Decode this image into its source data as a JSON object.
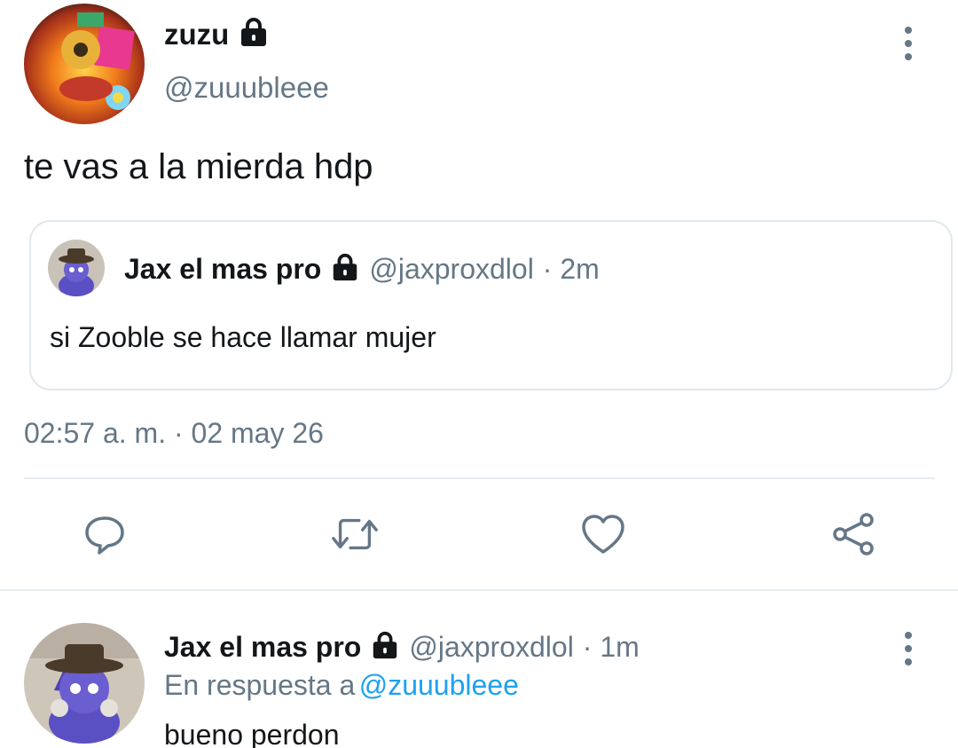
{
  "main_tweet": {
    "display_name": "zuzu",
    "handle": "@zuuubleee",
    "text": "te vas a la mierda hdp",
    "timestamp": "02:57 a. m. · 02 may 26",
    "icons": {
      "avatar": "avatar",
      "lock": "lock-icon",
      "more": "more-options-icon"
    }
  },
  "quoted_tweet": {
    "display_name": "Jax el mas pro",
    "handle": "@jaxproxdlol",
    "time": "· 2m",
    "text": "si Zooble se hace llamar mujer"
  },
  "actions": [
    {
      "name": "reply",
      "icon": "reply-icon"
    },
    {
      "name": "retweet",
      "icon": "retweet-icon"
    },
    {
      "name": "like",
      "icon": "heart-icon"
    },
    {
      "name": "share",
      "icon": "share-icon"
    }
  ],
  "reply_tweet": {
    "display_name": "Jax el mas pro",
    "handle": "@jaxproxdlol",
    "time": "· 1m",
    "reply_prefix": "En respuesta a",
    "reply_to": "@zuuubleee",
    "text": "bueno perdon"
  },
  "colors": {
    "text": "#14171a",
    "secondary": "#657786",
    "link": "#1da1f2",
    "border": "#e1e8ed"
  }
}
